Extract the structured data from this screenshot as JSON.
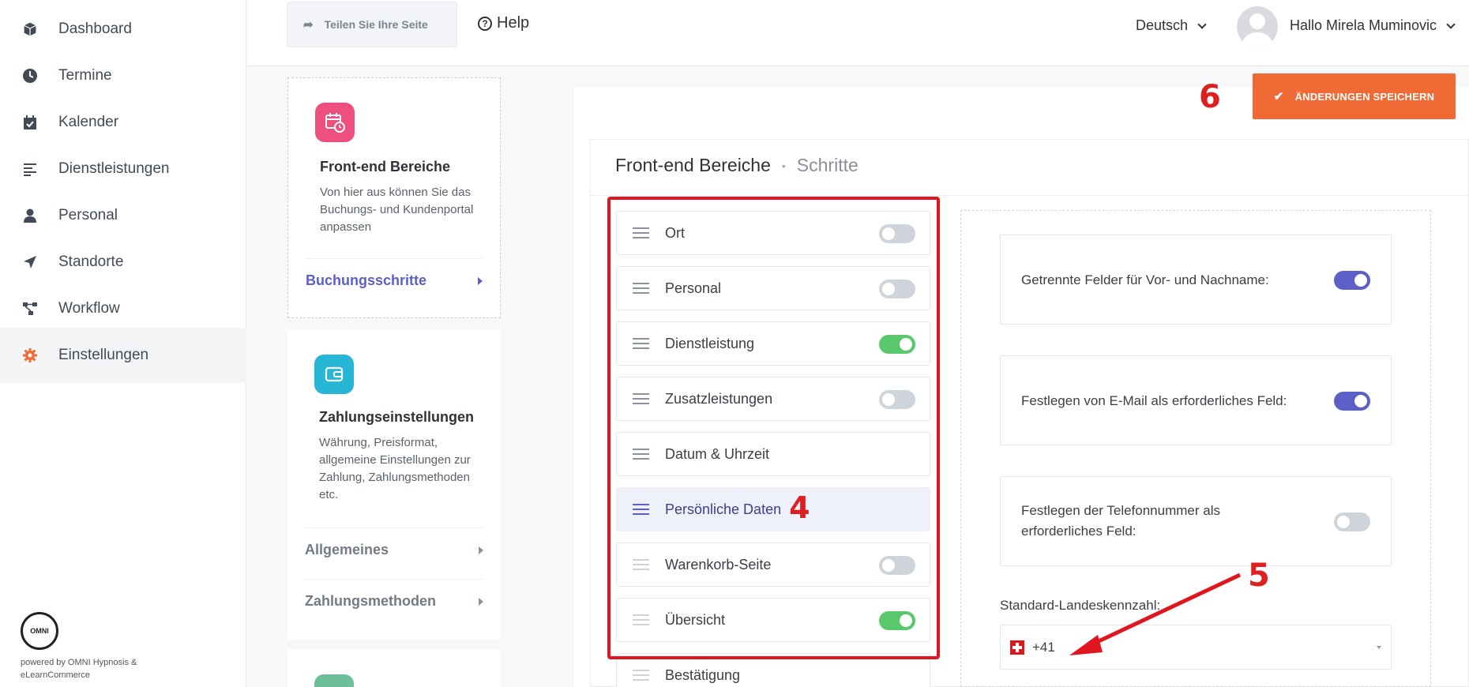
{
  "sidebar": {
    "items": [
      {
        "label": "Dashboard",
        "icon": "cube-icon"
      },
      {
        "label": "Termine",
        "icon": "clock-icon"
      },
      {
        "label": "Kalender",
        "icon": "calendar-check-icon"
      },
      {
        "label": "Dienstleistungen",
        "icon": "list-icon"
      },
      {
        "label": "Personal",
        "icon": "user-icon"
      },
      {
        "label": "Standorte",
        "icon": "location-arrow-icon"
      },
      {
        "label": "Workflow",
        "icon": "workflow-icon"
      },
      {
        "label": "Einstellungen",
        "icon": "gear-icon",
        "active": true
      }
    ],
    "brand_logo_text": "OMNI",
    "brand_text": "powered by OMNI Hypnosis & eLearnCommerce"
  },
  "topbar": {
    "share_label": "Teilen Sie Ihre Seite",
    "help_label": "Help",
    "language": "Deutsch",
    "greeting": "Hallo Mirela Muminovic"
  },
  "settings_cards": [
    {
      "title": "Front-end Bereiche",
      "description": "Von hier aus können Sie das Buchungs- und Kundenportal anpassen",
      "links": [
        "Buchungsschritte"
      ],
      "icon_color": "#ef4f7e"
    },
    {
      "title": "Zahlungseinstellungen",
      "description": "Währung, Preisformat, allgemeine Einstellungen zur Zahlung, Zahlungsmethoden etc.",
      "links": [
        "Allgemeines",
        "Zahlungsmethoden"
      ],
      "icon_color": "#27b6d6"
    }
  ],
  "save_button": "ÄNDERUNGEN SPEICHERN",
  "annotations": {
    "four": "4",
    "five": "5",
    "six": "6"
  },
  "section": {
    "title": "Front-end Bereiche",
    "subtitle": "Schritte"
  },
  "steps": [
    {
      "label": "Ort",
      "toggle": "off"
    },
    {
      "label": "Personal",
      "toggle": "off"
    },
    {
      "label": "Dienstleistung",
      "toggle": "on"
    },
    {
      "label": "Zusatzleistungen",
      "toggle": "off"
    },
    {
      "label": "Datum & Uhrzeit",
      "toggle": "none"
    },
    {
      "label": "Persönliche Daten",
      "toggle": "none",
      "active": true
    },
    {
      "label": "Warenkorb-Seite",
      "toggle": "off"
    },
    {
      "label": "Übersicht",
      "toggle": "on"
    },
    {
      "label": "Bestätigung",
      "toggle": "none"
    }
  ],
  "options": [
    {
      "label": "Getrennte Felder für Vor- und Nachname:",
      "toggle": "on"
    },
    {
      "label": "Festlegen von E-Mail als erforderliches Feld:",
      "toggle": "on"
    },
    {
      "label": "Festlegen der Telefonnummer als erforderliches Feld:",
      "toggle": "off"
    }
  ],
  "phone": {
    "label": "Standard-Landeskennzahl:",
    "value": "+41",
    "flag": "swiss-flag-icon"
  },
  "colors": {
    "accent": "#5b5fc7",
    "save": "#ef6a35",
    "toggle_on": "#59c86c",
    "annotation": "#e0161e"
  }
}
